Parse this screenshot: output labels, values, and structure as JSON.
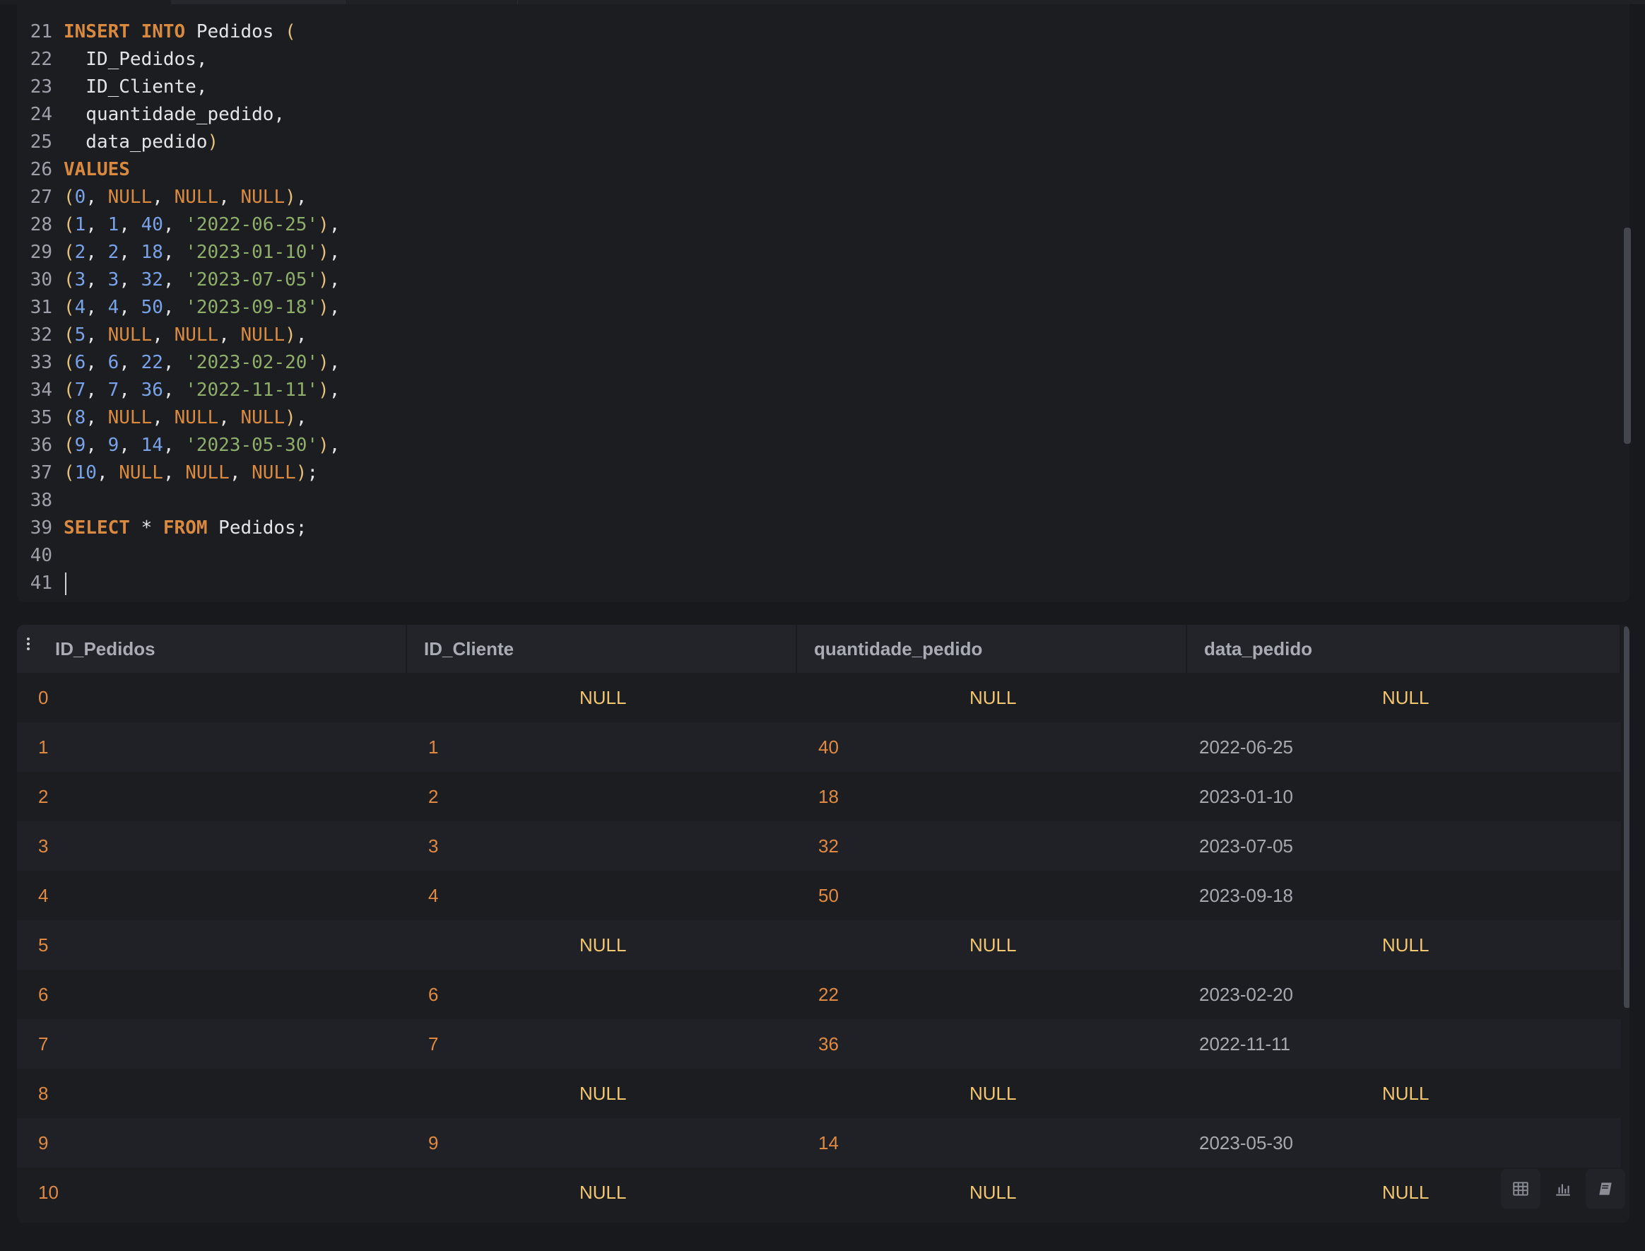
{
  "editor": {
    "lines": [
      {
        "n": "21",
        "tokens": [
          [
            "kw",
            "INSERT"
          ],
          [
            "pu",
            " "
          ],
          [
            "kw",
            "INTO"
          ],
          [
            "id",
            " Pedidos "
          ],
          [
            "pa",
            "("
          ]
        ]
      },
      {
        "n": "22",
        "tokens": [
          [
            "id",
            "  ID_Pedidos,"
          ]
        ]
      },
      {
        "n": "23",
        "tokens": [
          [
            "id",
            "  ID_Cliente,"
          ]
        ]
      },
      {
        "n": "24",
        "tokens": [
          [
            "id",
            "  quantidade_pedido,"
          ]
        ]
      },
      {
        "n": "25",
        "tokens": [
          [
            "id",
            "  data_pedido"
          ],
          [
            "pa",
            ")"
          ]
        ]
      },
      {
        "n": "26",
        "tokens": [
          [
            "kw",
            "VALUES"
          ]
        ]
      },
      {
        "n": "27",
        "tokens": [
          [
            "pa",
            "("
          ],
          [
            "nu",
            "0"
          ],
          [
            "pu",
            ", "
          ],
          [
            "nl",
            "NULL"
          ],
          [
            "pu",
            ", "
          ],
          [
            "nl",
            "NULL"
          ],
          [
            "pu",
            ", "
          ],
          [
            "nl",
            "NULL"
          ],
          [
            "pa",
            ")"
          ],
          [
            "pu",
            ","
          ]
        ]
      },
      {
        "n": "28",
        "tokens": [
          [
            "pa",
            "("
          ],
          [
            "nu",
            "1"
          ],
          [
            "pu",
            ", "
          ],
          [
            "nu",
            "1"
          ],
          [
            "pu",
            ", "
          ],
          [
            "nu",
            "40"
          ],
          [
            "pu",
            ", "
          ],
          [
            "st",
            "'2022-06-25'"
          ],
          [
            "pa",
            ")"
          ],
          [
            "pu",
            ","
          ]
        ]
      },
      {
        "n": "29",
        "tokens": [
          [
            "pa",
            "("
          ],
          [
            "nu",
            "2"
          ],
          [
            "pu",
            ", "
          ],
          [
            "nu",
            "2"
          ],
          [
            "pu",
            ", "
          ],
          [
            "nu",
            "18"
          ],
          [
            "pu",
            ", "
          ],
          [
            "st",
            "'2023-01-10'"
          ],
          [
            "pa",
            ")"
          ],
          [
            "pu",
            ","
          ]
        ]
      },
      {
        "n": "30",
        "tokens": [
          [
            "pa",
            "("
          ],
          [
            "nu",
            "3"
          ],
          [
            "pu",
            ", "
          ],
          [
            "nu",
            "3"
          ],
          [
            "pu",
            ", "
          ],
          [
            "nu",
            "32"
          ],
          [
            "pu",
            ", "
          ],
          [
            "st",
            "'2023-07-05'"
          ],
          [
            "pa",
            ")"
          ],
          [
            "pu",
            ","
          ]
        ]
      },
      {
        "n": "31",
        "tokens": [
          [
            "pa",
            "("
          ],
          [
            "nu",
            "4"
          ],
          [
            "pu",
            ", "
          ],
          [
            "nu",
            "4"
          ],
          [
            "pu",
            ", "
          ],
          [
            "nu",
            "50"
          ],
          [
            "pu",
            ", "
          ],
          [
            "st",
            "'2023-09-18'"
          ],
          [
            "pa",
            ")"
          ],
          [
            "pu",
            ","
          ]
        ]
      },
      {
        "n": "32",
        "tokens": [
          [
            "pa",
            "("
          ],
          [
            "nu",
            "5"
          ],
          [
            "pu",
            ", "
          ],
          [
            "nl",
            "NULL"
          ],
          [
            "pu",
            ", "
          ],
          [
            "nl",
            "NULL"
          ],
          [
            "pu",
            ", "
          ],
          [
            "nl",
            "NULL"
          ],
          [
            "pa",
            ")"
          ],
          [
            "pu",
            ","
          ]
        ]
      },
      {
        "n": "33",
        "tokens": [
          [
            "pa",
            "("
          ],
          [
            "nu",
            "6"
          ],
          [
            "pu",
            ", "
          ],
          [
            "nu",
            "6"
          ],
          [
            "pu",
            ", "
          ],
          [
            "nu",
            "22"
          ],
          [
            "pu",
            ", "
          ],
          [
            "st",
            "'2023-02-20'"
          ],
          [
            "pa",
            ")"
          ],
          [
            "pu",
            ","
          ]
        ]
      },
      {
        "n": "34",
        "tokens": [
          [
            "pa",
            "("
          ],
          [
            "nu",
            "7"
          ],
          [
            "pu",
            ", "
          ],
          [
            "nu",
            "7"
          ],
          [
            "pu",
            ", "
          ],
          [
            "nu",
            "36"
          ],
          [
            "pu",
            ", "
          ],
          [
            "st",
            "'2022-11-11'"
          ],
          [
            "pa",
            ")"
          ],
          [
            "pu",
            ","
          ]
        ]
      },
      {
        "n": "35",
        "tokens": [
          [
            "pa",
            "("
          ],
          [
            "nu",
            "8"
          ],
          [
            "pu",
            ", "
          ],
          [
            "nl",
            "NULL"
          ],
          [
            "pu",
            ", "
          ],
          [
            "nl",
            "NULL"
          ],
          [
            "pu",
            ", "
          ],
          [
            "nl",
            "NULL"
          ],
          [
            "pa",
            ")"
          ],
          [
            "pu",
            ","
          ]
        ]
      },
      {
        "n": "36",
        "tokens": [
          [
            "pa",
            "("
          ],
          [
            "nu",
            "9"
          ],
          [
            "pu",
            ", "
          ],
          [
            "nu",
            "9"
          ],
          [
            "pu",
            ", "
          ],
          [
            "nu",
            "14"
          ],
          [
            "pu",
            ", "
          ],
          [
            "st",
            "'2023-05-30'"
          ],
          [
            "pa",
            ")"
          ],
          [
            "pu",
            ","
          ]
        ]
      },
      {
        "n": "37",
        "tokens": [
          [
            "pa",
            "("
          ],
          [
            "nu",
            "10"
          ],
          [
            "pu",
            ", "
          ],
          [
            "nl",
            "NULL"
          ],
          [
            "pu",
            ", "
          ],
          [
            "nl",
            "NULL"
          ],
          [
            "pu",
            ", "
          ],
          [
            "nl",
            "NULL"
          ],
          [
            "pa",
            ")"
          ],
          [
            "pu",
            ";"
          ]
        ]
      },
      {
        "n": "38",
        "tokens": []
      },
      {
        "n": "39",
        "tokens": [
          [
            "kw",
            "SELECT"
          ],
          [
            "id",
            " * "
          ],
          [
            "kw",
            "FROM"
          ],
          [
            "id",
            " Pedidos;"
          ]
        ]
      },
      {
        "n": "40",
        "tokens": []
      },
      {
        "n": "41",
        "tokens": [],
        "cursor": true
      }
    ]
  },
  "results": {
    "columns": [
      "ID_Pedidos",
      "ID_Cliente",
      "quantidade_pedido",
      "data_pedido"
    ],
    "rows": [
      [
        "0",
        "NULL",
        "NULL",
        "NULL"
      ],
      [
        "1",
        "1",
        "40",
        "2022-06-25"
      ],
      [
        "2",
        "2",
        "18",
        "2023-01-10"
      ],
      [
        "3",
        "3",
        "32",
        "2023-07-05"
      ],
      [
        "4",
        "4",
        "50",
        "2023-09-18"
      ],
      [
        "5",
        "NULL",
        "NULL",
        "NULL"
      ],
      [
        "6",
        "6",
        "22",
        "2023-02-20"
      ],
      [
        "7",
        "7",
        "36",
        "2022-11-11"
      ],
      [
        "8",
        "NULL",
        "NULL",
        "NULL"
      ],
      [
        "9",
        "9",
        "14",
        "2023-05-30"
      ],
      [
        "10",
        "NULL",
        "NULL",
        "NULL"
      ]
    ],
    "view_buttons": [
      {
        "name": "table-view-icon"
      },
      {
        "name": "chart-view-icon"
      },
      {
        "name": "notebook-view-icon"
      }
    ]
  },
  "colors": {
    "keyword": "#d98a3f",
    "number": "#7aa2e8",
    "string": "#8fae6a",
    "null_result": "#f1c66e",
    "num_result": "#e18a3f"
  }
}
